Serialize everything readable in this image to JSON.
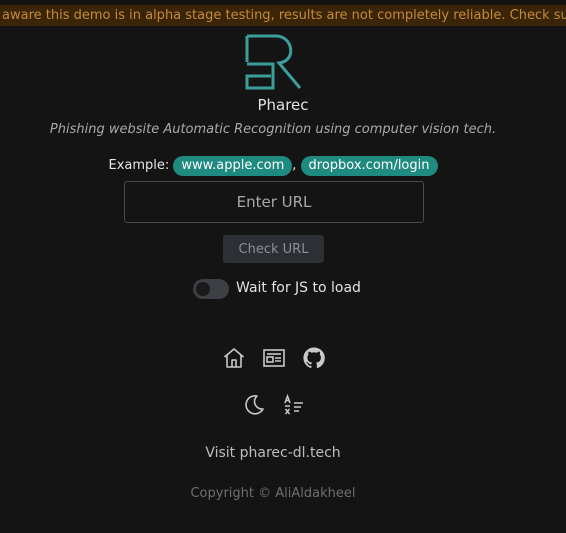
{
  "banner": {
    "text": "aware this demo is in alpha stage testing, results are not completely reliable. Check supp"
  },
  "app": {
    "name": "Pharec",
    "tagline": "Phishing website Automatic Recognition using computer vision tech."
  },
  "example": {
    "label": "Example:",
    "separator": ",",
    "links": [
      "www.apple.com",
      "dropbox.com/login"
    ]
  },
  "form": {
    "url_placeholder": "Enter URL",
    "url_value": "",
    "check_button": "Check URL",
    "wait_js_label": "Wait for JS to load",
    "wait_js_enabled": false
  },
  "footer": {
    "icons_row1": [
      "home-icon",
      "news-icon",
      "github-icon"
    ],
    "icons_row2": [
      "moon-icon",
      "translate-icon"
    ],
    "visit_text": "Visit pharec-dl.tech",
    "copyright": "Copyright © AliAldakheel"
  },
  "colors": {
    "background": "#141414",
    "accent": "#1f8a7f",
    "logo": "#3a9e9a",
    "banner_bg": "#3a2508",
    "banner_text": "#c58a3a"
  }
}
